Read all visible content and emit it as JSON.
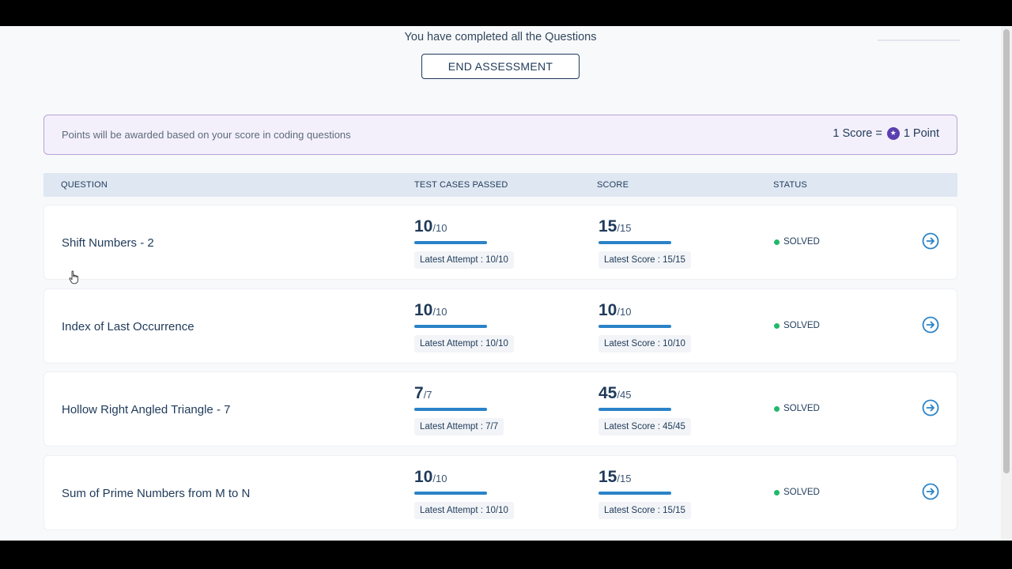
{
  "header": {
    "completed_message": "You have completed all the Questions",
    "end_button_label": "END ASSESSMENT"
  },
  "points_banner": {
    "text": "Points will be awarded based on your score in coding questions",
    "rule_left": "1 Score =",
    "rule_right": "1 Point",
    "coin_icon": "star-coin-icon"
  },
  "table": {
    "columns": {
      "question": "QUESTION",
      "test_cases": "TEST CASES PASSED",
      "score": "SCORE",
      "status": "STATUS"
    },
    "rows": [
      {
        "question": "Shift Numbers - 2",
        "tests_passed": "10",
        "tests_total": "/10",
        "tests_fraction": 1.0,
        "tests_attempt": "Latest Attempt : 10/10",
        "score": "15",
        "score_total": "/15",
        "score_fraction": 1.0,
        "score_latest": "Latest Score : 15/15",
        "status": "SOLVED"
      },
      {
        "question": "Index of Last Occurrence",
        "tests_passed": "10",
        "tests_total": "/10",
        "tests_fraction": 1.0,
        "tests_attempt": "Latest Attempt : 10/10",
        "score": "10",
        "score_total": "/10",
        "score_fraction": 1.0,
        "score_latest": "Latest Score : 10/10",
        "status": "SOLVED"
      },
      {
        "question": "Hollow Right Angled Triangle - 7",
        "tests_passed": "7",
        "tests_total": "/7",
        "tests_fraction": 1.0,
        "tests_attempt": "Latest Attempt : 7/7",
        "score": "45",
        "score_total": "/45",
        "score_fraction": 1.0,
        "score_latest": "Latest Score : 45/45",
        "status": "SOLVED"
      },
      {
        "question": "Sum of Prime Numbers from M to N",
        "tests_passed": "10",
        "tests_total": "/10",
        "tests_fraction": 1.0,
        "tests_attempt": "Latest Attempt : 10/10",
        "score": "15",
        "score_total": "/15",
        "score_fraction": 1.0,
        "score_latest": "Latest Score : 15/15",
        "status": "SOLVED"
      }
    ]
  },
  "colors": {
    "accent": "#2a83c8",
    "text_primary": "#1f3a5a",
    "solved_green": "#22b86b",
    "banner_border": "#b9a3d6",
    "coin_purple": "#5a3fb0"
  },
  "icons": {
    "row_action": "arrow-circle-right-icon",
    "status": "status-dot-icon"
  }
}
